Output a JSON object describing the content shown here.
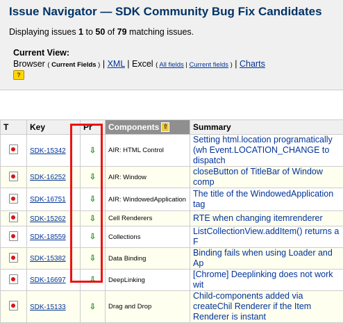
{
  "navigator": {
    "title": "Issue Navigator — SDK Community Bug Fix Candidates",
    "displaying_prefix": "Displaying issues ",
    "range_start": "1",
    "range_to": " to ",
    "range_end": "50",
    "of_text": " of ",
    "total": "79",
    "suffix": " matching issues."
  },
  "current_view": {
    "heading": "Current View:",
    "browser": "Browser",
    "current_fields_label": "Current Fields",
    "xml": "XML",
    "excel": "Excel",
    "all_fields": "All fields",
    "current_fields": "Current fields",
    "charts": "Charts",
    "help_icon": "help-icon"
  },
  "table": {
    "headers": [
      "T",
      "Key",
      "Pr",
      "Components",
      "Summary"
    ],
    "sorted_column": "Components",
    "rows": [
      {
        "key": "SDK-15342",
        "component": "AIR: HTML Control",
        "summary": "Setting html.location programatically (wh Event.LOCATION_CHANGE to dispatch"
      },
      {
        "key": "SDK-16252",
        "component": "AIR: Window",
        "summary": "closeButton of TitleBar of Window comp"
      },
      {
        "key": "SDK-16751",
        "component": "AIR: WindowedApplication",
        "summary": "The title of the WindowedApplication tag"
      },
      {
        "key": "SDK-15262",
        "component": "Cell Renderers",
        "summary": "RTE when changing itemrenderer"
      },
      {
        "key": "SDK-18559",
        "component": "Collections",
        "summary": "ListCollectionView.addItem() returns a F"
      },
      {
        "key": "SDK-15382",
        "component": "Data Binding",
        "summary": "Binding fails when using Loader and Ap"
      },
      {
        "key": "SDK-16697",
        "component": "DeepLinking",
        "summary": "[Chrome] Deeplinking does not work wit"
      },
      {
        "key": "SDK-15133",
        "component": "Drag and Drop",
        "summary": "Child-components added via createChil Renderer if the Item Renderer is instant"
      }
    ]
  },
  "colors": {
    "title": "#003366",
    "highlight": "#ee1111",
    "priority_arrow": "#2e9a2e"
  }
}
